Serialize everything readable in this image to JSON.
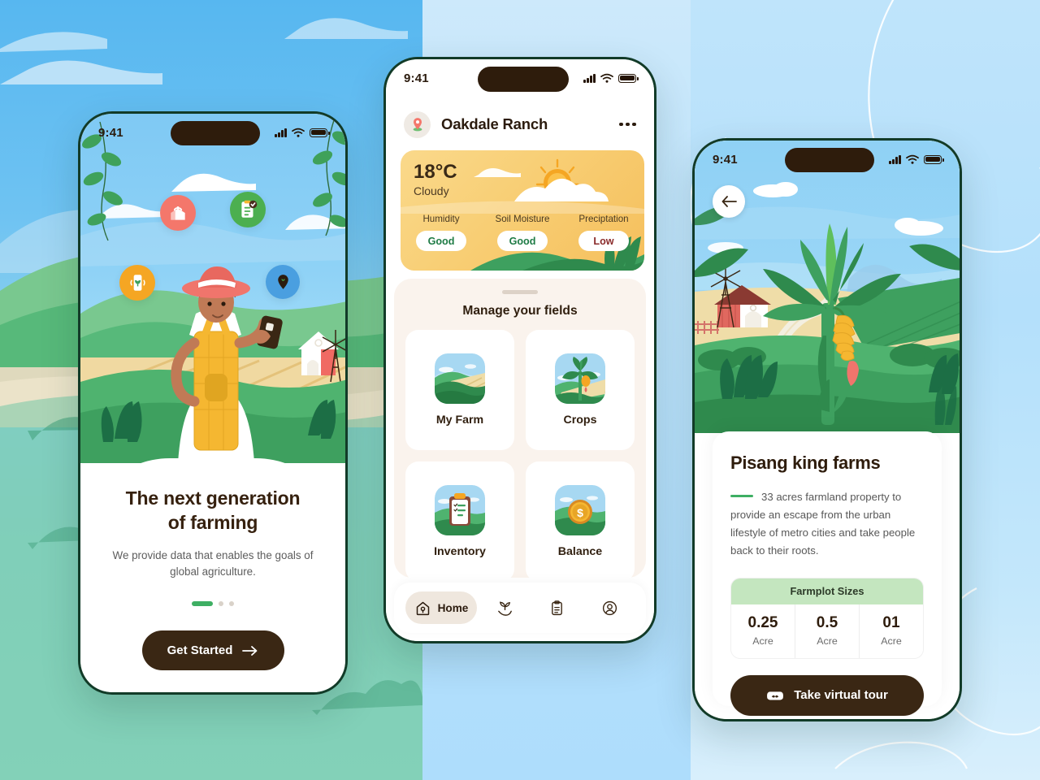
{
  "background": {
    "left_panel_color": "#6FC3F2",
    "mid_panel_color": "#BEE4FC",
    "right_panel_color": "#BFE4FB"
  },
  "phone1": {
    "status": {
      "time": "9:41",
      "signal_icon": "signal-bars-icon",
      "wifi_icon": "wifi-icon",
      "battery_icon": "battery-icon"
    },
    "floating_icons": [
      {
        "name": "smart-barn-icon",
        "color": "#F4776B"
      },
      {
        "name": "checklist-icon",
        "color": "#4CAF50"
      },
      {
        "name": "mobile-crop-sensor-icon",
        "color": "#F5A623"
      },
      {
        "name": "location-pin-icon",
        "color": "#4A9FE0"
      }
    ],
    "illustration": "farmer-with-phone-illustration",
    "title_line1": "The next generation",
    "title_line2": "of farming",
    "subtitle": "We provide data that enables the goals of global agriculture.",
    "pagination": {
      "total": 3,
      "active_index": 0
    },
    "cta_label": "Get Started",
    "cta_icon": "arrow-right-icon",
    "accent_green": "#3EAF63",
    "cta_background": "#3A2714"
  },
  "phone2": {
    "status": {
      "time": "9:41"
    },
    "header": {
      "avatar_icon": "location-pin-avatar-icon",
      "farm_name": "Oakdale Ranch",
      "menu_icon": "more-horizontal-icon"
    },
    "weather": {
      "temperature": "18°C",
      "condition": "Cloudy",
      "scene_icon": "sun-behind-cloud-icon",
      "metrics": [
        {
          "label": "Humidity",
          "value": "Good",
          "status": "good"
        },
        {
          "label": "Soil Moisture",
          "value": "Good",
          "status": "good"
        },
        {
          "label": "Preciptation",
          "value": "Low",
          "status": "low"
        }
      ]
    },
    "sheet": {
      "title": "Manage your fields",
      "tiles": [
        {
          "label": "My Farm",
          "icon": "farm-fields-icon"
        },
        {
          "label": "Crops",
          "icon": "banana-tree-icon"
        },
        {
          "label": "Inventory",
          "icon": "clipboard-checklist-icon"
        },
        {
          "label": "Balance",
          "icon": "gold-coin-dollar-icon"
        }
      ]
    },
    "tabs": [
      {
        "label": "Home",
        "icon": "home-icon",
        "active": true
      },
      {
        "label": "",
        "icon": "seedling-in-hand-icon",
        "active": false
      },
      {
        "label": "",
        "icon": "clipboard-icon",
        "active": false
      },
      {
        "label": "",
        "icon": "user-profile-icon",
        "active": false
      }
    ]
  },
  "phone3": {
    "status": {
      "time": "9:41"
    },
    "back_icon": "arrow-left-icon",
    "illustration": "banana-plantation-illustration",
    "title": "Pisang king farms",
    "description": "33 acres farmland property to provide an escape from the urban lifestyle of metro cities and take people back to their roots.",
    "plots": {
      "header": "Farmplot Sizes",
      "header_color": "#C4E6BF",
      "items": [
        {
          "value": "0.25",
          "unit": "Acre"
        },
        {
          "value": "0.5",
          "unit": "Acre"
        },
        {
          "value": "01",
          "unit": "Acre"
        }
      ]
    },
    "cta_label": "Take virtual tour",
    "cta_icon": "vr-headset-icon"
  }
}
